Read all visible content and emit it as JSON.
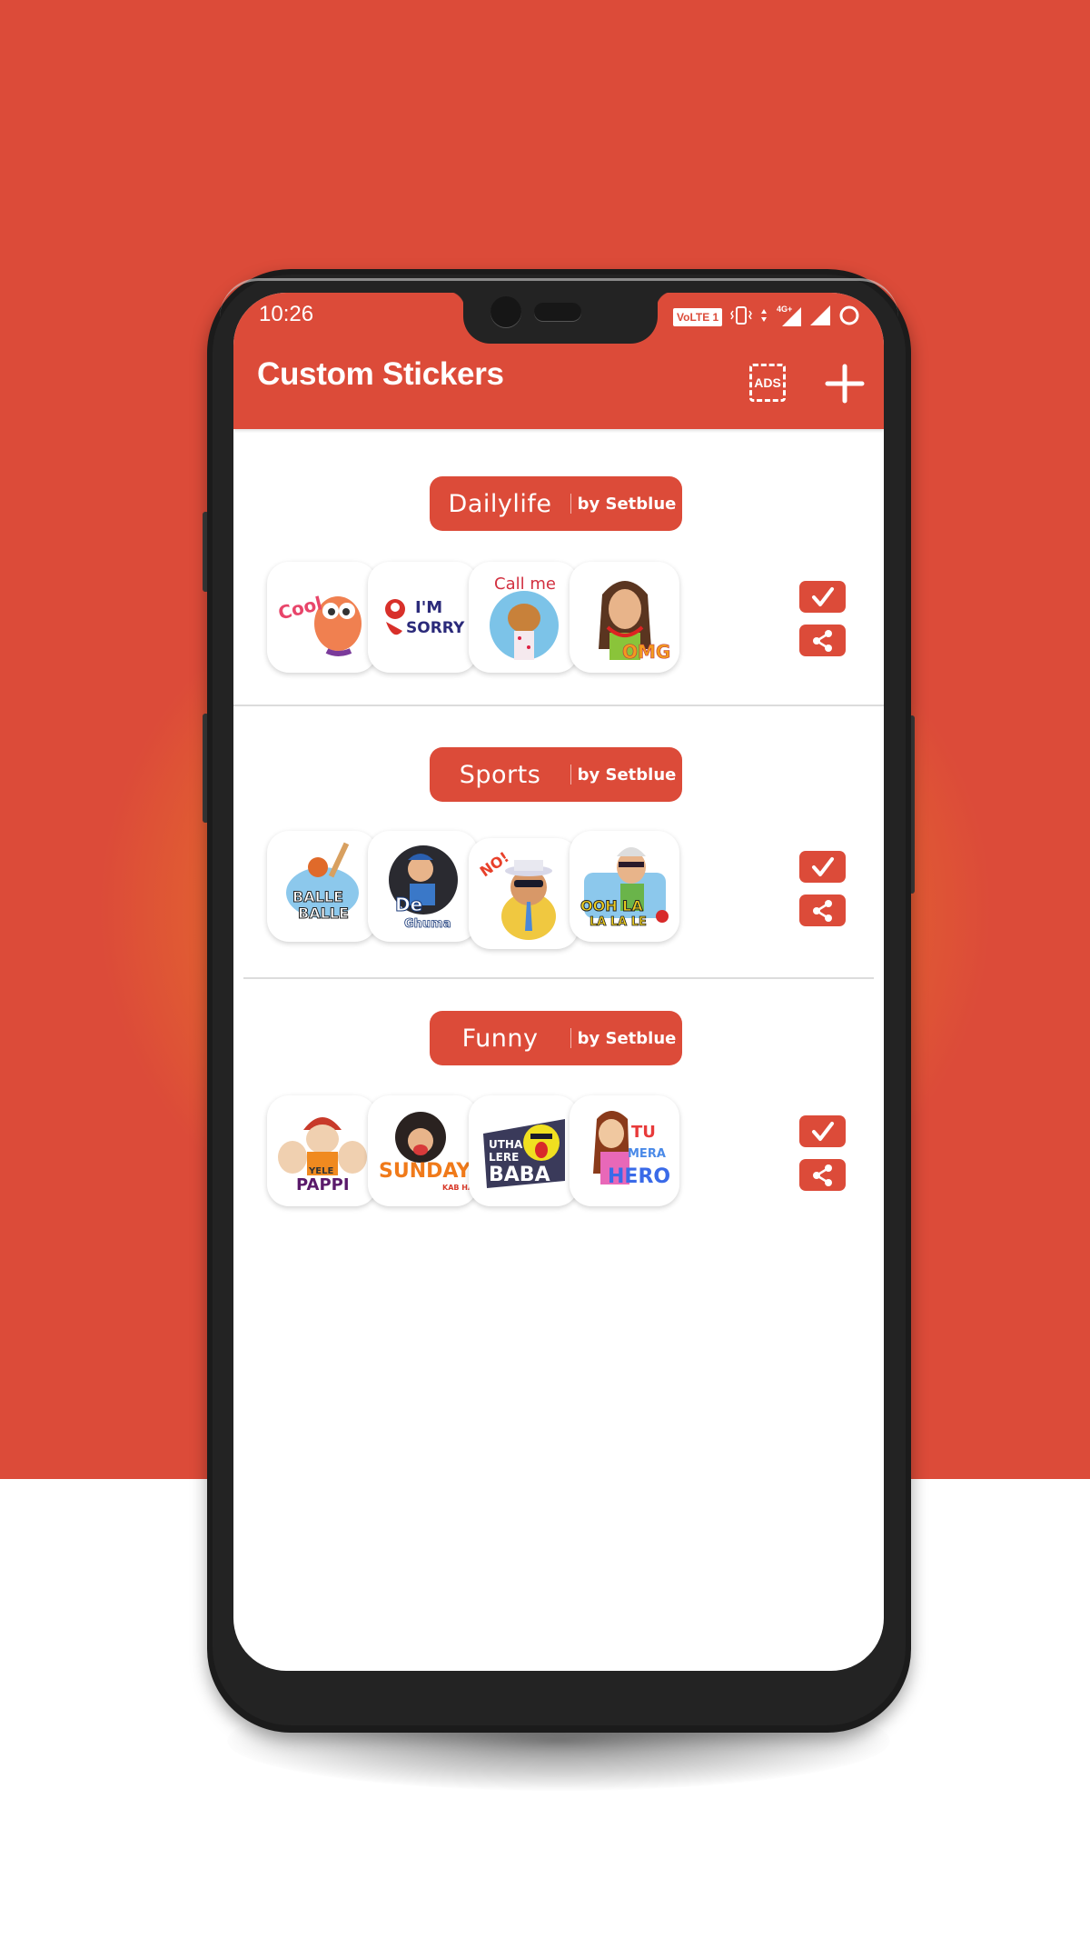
{
  "status_bar": {
    "time": "10:26",
    "volte_label": "VoLTE 1",
    "network_label": "4G+",
    "icons": [
      "volte-icon",
      "vibrate-icon",
      "data-arrows-icon",
      "signal-4g-icon",
      "signal-icon",
      "battery-ring-icon"
    ]
  },
  "app_bar": {
    "title": "Custom Stickers",
    "ads_label": "ADS",
    "ads_icon": "remove-ads-icon",
    "add_icon": "plus-icon"
  },
  "theme": {
    "accent": "#dc4b39",
    "background_lower": "#ffffff",
    "phone_frame": "#1b1b1b"
  },
  "packs": [
    {
      "name": "Dailylife",
      "author": "by Setblue",
      "stickers": [
        {
          "caption": "Cool",
          "icon": "cat-sticker"
        },
        {
          "caption": "I'M SORRY",
          "icon": "bee-sticker"
        },
        {
          "caption": "Call me",
          "icon": "bear-phone-sticker"
        },
        {
          "caption": "OMG",
          "icon": "woman-omg-sticker"
        }
      ],
      "add_icon": "check-icon",
      "share_icon": "share-icon"
    },
    {
      "name": "Sports",
      "author": "by Setblue",
      "stickers": [
        {
          "caption": "BALLE BALLE",
          "icon": "cricketer-dance-sticker"
        },
        {
          "caption": "De Ghuma Ke",
          "icon": "batsman-sticker"
        },
        {
          "caption": "NO!",
          "icon": "umpire-sticker"
        },
        {
          "caption": "OOH LA LA LA LE",
          "icon": "fan-sticker"
        }
      ],
      "add_icon": "check-icon",
      "share_icon": "share-icon"
    },
    {
      "name": "Funny",
      "author": "by Setblue",
      "stickers": [
        {
          "caption": "YELE PAPPI",
          "icon": "sikh-man-sticker"
        },
        {
          "caption": "SUNDAY KAB HAI",
          "icon": "angry-man-sticker"
        },
        {
          "caption": "UTHA LERE BABA",
          "icon": "crying-emoji-sticker"
        },
        {
          "caption": "TU MERA HERO",
          "icon": "woman-hero-sticker"
        }
      ],
      "add_icon": "check-icon",
      "share_icon": "share-icon"
    }
  ]
}
